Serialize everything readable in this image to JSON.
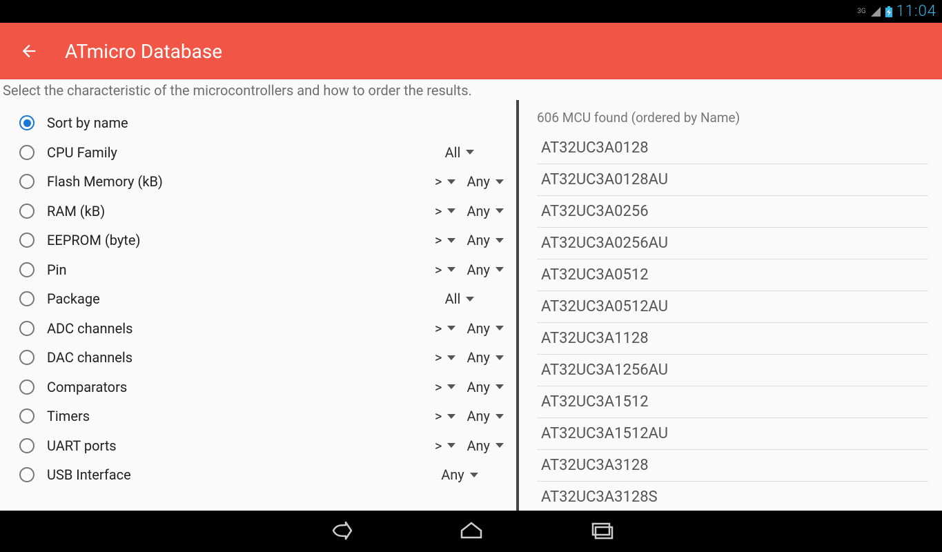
{
  "status_bar": {
    "network": "3G",
    "time": "11:04"
  },
  "app_bar": {
    "title": "ATmicro Database"
  },
  "subtitle": "Select the characteristic of the microcontrollers and how to order the results.",
  "filters": [
    {
      "label": "Sort by name",
      "checked": true,
      "controls": []
    },
    {
      "label": "CPU Family",
      "checked": false,
      "controls": [
        {
          "value": "All",
          "wide": true
        }
      ]
    },
    {
      "label": "Flash Memory (kB)",
      "checked": false,
      "controls": [
        {
          "value": ">"
        },
        {
          "value": "Any"
        }
      ]
    },
    {
      "label": "RAM (kB)",
      "checked": false,
      "controls": [
        {
          "value": ">"
        },
        {
          "value": "Any"
        }
      ]
    },
    {
      "label": "EEPROM (byte)",
      "checked": false,
      "controls": [
        {
          "value": ">"
        },
        {
          "value": "Any"
        }
      ]
    },
    {
      "label": "Pin",
      "checked": false,
      "controls": [
        {
          "value": ">"
        },
        {
          "value": "Any"
        }
      ]
    },
    {
      "label": "Package",
      "checked": false,
      "controls": [
        {
          "value": "All",
          "wide": true
        }
      ]
    },
    {
      "label": "ADC channels",
      "checked": false,
      "controls": [
        {
          "value": ">"
        },
        {
          "value": "Any"
        }
      ]
    },
    {
      "label": "DAC channels",
      "checked": false,
      "controls": [
        {
          "value": ">"
        },
        {
          "value": "Any"
        }
      ]
    },
    {
      "label": "Comparators",
      "checked": false,
      "controls": [
        {
          "value": ">"
        },
        {
          "value": "Any"
        }
      ]
    },
    {
      "label": "Timers",
      "checked": false,
      "controls": [
        {
          "value": ">"
        },
        {
          "value": "Any"
        }
      ]
    },
    {
      "label": "UART ports",
      "checked": false,
      "controls": [
        {
          "value": ">"
        },
        {
          "value": "Any"
        }
      ]
    },
    {
      "label": "USB Interface",
      "checked": false,
      "controls": [
        {
          "value": "Any",
          "wide": true
        }
      ]
    }
  ],
  "results": {
    "header": "606 MCU found (ordered by Name)",
    "items": [
      "AT32UC3A0128",
      "AT32UC3A0128AU",
      "AT32UC3A0256",
      "AT32UC3A0256AU",
      "AT32UC3A0512",
      "AT32UC3A0512AU",
      "AT32UC3A1128",
      "AT32UC3A1256AU",
      "AT32UC3A1512",
      "AT32UC3A1512AU",
      "AT32UC3A3128",
      "AT32UC3A3128S"
    ]
  }
}
